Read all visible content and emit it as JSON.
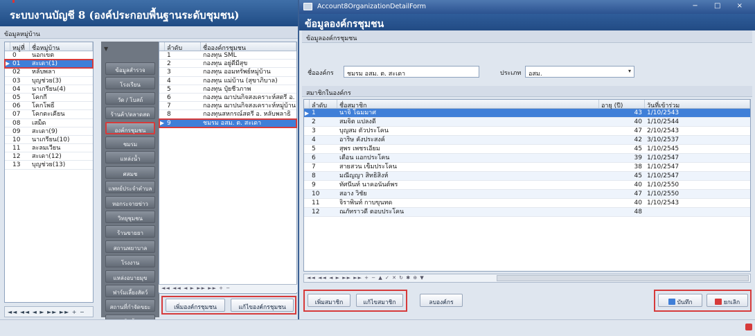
{
  "main": {
    "title": "ระบบงานบัญชี 8 (องค์ประกอบพื้นฐานระดับชุมชน)",
    "village_section": "ข้อมูลหมู่บ้าน",
    "village_headers": [
      "หมู่ที่",
      "ชื่อหมู่บ้าน"
    ],
    "villages": [
      {
        "no": "0",
        "name": "นอกเขต"
      },
      {
        "no": "01",
        "name": "สะเดา(1)"
      },
      {
        "no": "02",
        "name": "หลับพลา"
      },
      {
        "no": "03",
        "name": "บุญช่วย(3)"
      },
      {
        "no": "04",
        "name": "นาเกรียน(4)"
      },
      {
        "no": "05",
        "name": "โคกกี่"
      },
      {
        "no": "06",
        "name": "โคกโพธิ์"
      },
      {
        "no": "07",
        "name": "โคกตะเคียน"
      },
      {
        "no": "08",
        "name": "เสม็ด"
      },
      {
        "no": "09",
        "name": "สะเดา(9)"
      },
      {
        "no": "10",
        "name": "นาเกรียน(10)"
      },
      {
        "no": "11",
        "name": "ละลมเวียน"
      },
      {
        "no": "12",
        "name": "สะเดา(12)"
      },
      {
        "no": "13",
        "name": "บุญช่วย(13)"
      }
    ],
    "menu": [
      "ข้อมูลสำรวจ",
      "โรงเรียน",
      "วัด / โบสถ์",
      "ร้านค้า/ตลาดสด",
      "องค์กรชุมชน",
      "ชมรม",
      "แหล่งน้ำ",
      "ศสมช",
      "แพทย์ประจำตำบล",
      "หอกระจายข่าว",
      "วิทยุชุมชน",
      "ร้านขายยา",
      "สถานพยาบาล",
      "โรงงาน",
      "แหล่งอบายมุข",
      "ฟาร์มเลี้ยงสัตว์",
      "สถานที่กำจัดขยะ",
      "ถังเก็บน้ำฝน"
    ],
    "org_headers": [
      "ลำดับ",
      "ชื่อองค์กรชุมชน"
    ],
    "orgs": [
      {
        "no": "1",
        "name": "กองทุน SML"
      },
      {
        "no": "2",
        "name": "กองทุน อยู่ดีมีสุข"
      },
      {
        "no": "3",
        "name": "กองทุน ออมทรัพย์หมู่บ้าน"
      },
      {
        "no": "4",
        "name": "กองทุน แม่บ้าน (สุขาภิบาล)"
      },
      {
        "no": "5",
        "name": "กองทุน ปุ๋ยชีวภาพ"
      },
      {
        "no": "6",
        "name": "กองทุน ฌาปนกิจสงเคราะห์สตรี อ."
      },
      {
        "no": "7",
        "name": "กองทุน ฌาปนกิจสงเคราะห์หมู่บ้าน"
      },
      {
        "no": "8",
        "name": "กองทุนสหกรณ์สตรี อ. หลับพลาธิ"
      },
      {
        "no": "9",
        "name": "ชมรม อสม. ต. สะเดา"
      }
    ],
    "nav_text": "◄◄ ◄◄ ◄ ► ►► ►► + − ",
    "add_org_label": "เพิ่มองค์กรชุมชน",
    "edit_org_label": "แก้ไของค์กรชุมชน"
  },
  "dialog": {
    "window_title": "Account8OrganizationDetailForm",
    "window_controls": "− □ ×",
    "header": "ข้อมูลองค์กรชุมชน",
    "section_org": "ข้อมูลองค์กรชุมชน",
    "org_name_label": "ชื่อองค์กร",
    "org_name_value": "ชมรม อสม. ต. สะเดา",
    "type_label": "ประเภท",
    "type_value": "อสม.",
    "section_members": "สมาชิกในองค์กร",
    "member_headers": [
      "ลำดับ",
      "ชื่อสมาชิก",
      "อายุ (ปี)",
      "วันที่เข้าร่วม"
    ],
    "members": [
      {
        "no": "1",
        "name": "นาจิ โฉมมาศ",
        "age": "43",
        "date": "1/10/2543"
      },
      {
        "no": "2",
        "name": "สมจิต แปลงดี",
        "age": "40",
        "date": "1/10/2544"
      },
      {
        "no": "3",
        "name": "บุญสม ตัวประโคน",
        "age": "47",
        "date": "2/10/2543"
      },
      {
        "no": "4",
        "name": "อาริษ คังประสงค์",
        "age": "42",
        "date": "3/10/2537"
      },
      {
        "no": "5",
        "name": "สุพร เพชรเอี่ยม",
        "age": "45",
        "date": "1/10/2545"
      },
      {
        "no": "6",
        "name": "เดือน แอกประโคน",
        "age": "39",
        "date": "1/10/2547"
      },
      {
        "no": "7",
        "name": "สายสวน เข็มประโคน",
        "age": "38",
        "date": "1/10/2547"
      },
      {
        "no": "8",
        "name": "มณีญญา สิทธิสิงห์",
        "age": "45",
        "date": "1/10/2547"
      },
      {
        "no": "9",
        "name": "ทัศนีนท์ นาคอนันต์พร",
        "age": "40",
        "date": "1/10/2550"
      },
      {
        "no": "10",
        "name": "สอาง วิชัย",
        "age": "47",
        "date": "1/10/2550"
      },
      {
        "no": "11",
        "name": "จิราพินท์ กาบขุนทด",
        "age": "40",
        "date": "1/10/2543"
      },
      {
        "no": "12",
        "name": "ณภัทราวดี ตอบประโคน",
        "age": "48",
        "date": ""
      }
    ],
    "nav_text": "◄◄ ◄◄ ◄ ► ►► ►► + − ▲ ✓ ✕ ↻ ✱ ⊕ ▼",
    "add_member_label": "เพิ่มสมาชิก",
    "edit_member_label": "แก้ไขสมาชิก",
    "delete_org_label": "ลบองค์กร",
    "save_label": "บันทึก",
    "cancel_label": "ยกเลิก"
  },
  "colors": {
    "accent": "#d63a3a",
    "selection": "#3f7fd8",
    "header": "#224b84"
  }
}
